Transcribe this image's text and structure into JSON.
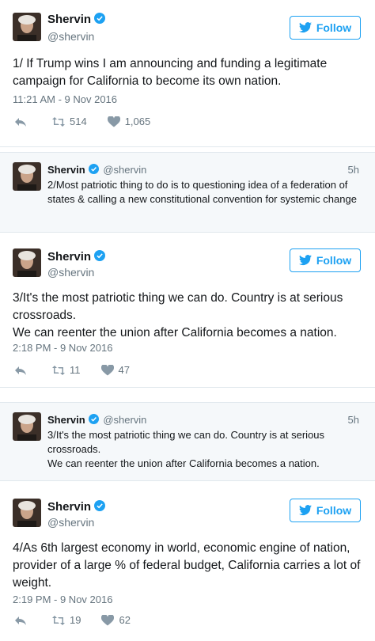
{
  "colors": {
    "accent": "#1da1f2",
    "text": "#14171a",
    "muted": "#66757f",
    "divider": "#e1e8ed",
    "reply_bg": "#f5f8fa"
  },
  "tweets": [
    {
      "name": "Shervin",
      "handle": "@shervin",
      "follow_label": "Follow",
      "text": "1/ If Trump wins I am announcing and funding a legitimate campaign for California to become its own nation.",
      "timestamp": "11:21 AM - 9 Nov 2016",
      "retweets": "514",
      "likes": "1,065"
    },
    {
      "name": "Shervin",
      "handle": "@shervin",
      "follow_label": "Follow",
      "text_line1": "3/It's the most patriotic thing we can do. Country is at serious crossroads.",
      "text_line2": "We can reenter the union after California becomes a nation.",
      "timestamp": "2:18 PM - 9 Nov 2016",
      "retweets": "11",
      "likes": "47"
    },
    {
      "name": "Shervin",
      "handle": "@shervin",
      "follow_label": "Follow",
      "text": "4/As 6th largest economy in world, economic engine of nation, provider of a large % of federal budget, California carries a lot of weight.",
      "timestamp": "2:19 PM - 9 Nov 2016",
      "retweets": "19",
      "likes": "62"
    }
  ],
  "replies": [
    {
      "name": "Shervin",
      "handle": "@shervin",
      "age": "5h",
      "text": "2/Most patriotic thing to do is to questioning idea of a federation of states & calling a new constitutional convention for systemic change"
    },
    {
      "name": "Shervin",
      "handle": "@shervin",
      "age": "5h",
      "text_line1": "3/It's the most patriotic thing we can do. Country is at serious crossroads.",
      "text_line2": "We can reenter the union after California becomes a nation."
    }
  ]
}
